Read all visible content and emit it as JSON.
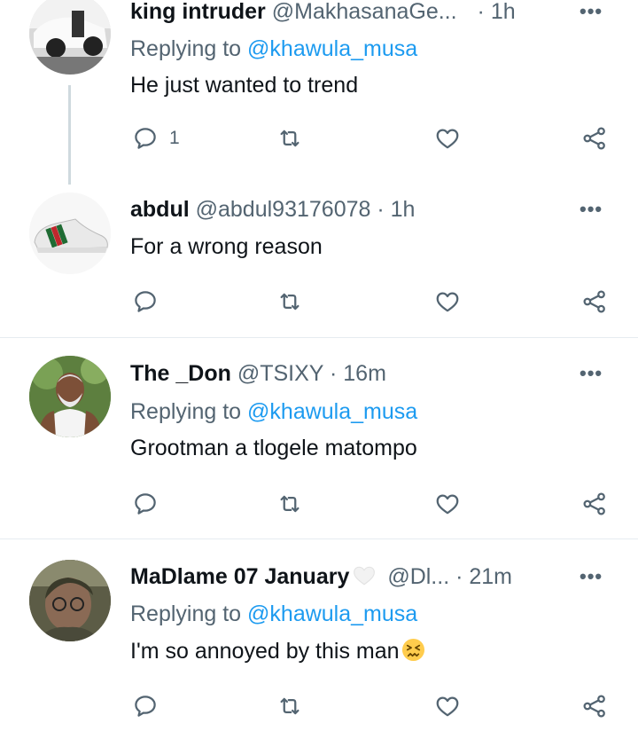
{
  "tweets": [
    {
      "name": "king intruder",
      "handle": "@MakhasanaGe...",
      "dot": "·",
      "time": "1h",
      "replying_prefix": "Replying to ",
      "replying_to": "@khawula_musa",
      "text": "He just wanted to trend",
      "reply_count": "1"
    },
    {
      "name": "abdul",
      "handle": "@abdul93176078",
      "dot": "·",
      "time": "1h",
      "text": "For a wrong reason"
    },
    {
      "name": "The _Don",
      "handle": "@TSIXY",
      "dot": "·",
      "time": "16m",
      "replying_prefix": "Replying to ",
      "replying_to": "@khawula_musa",
      "text": "Grootman a tlogele matompo"
    },
    {
      "name": "MaDlame 07 January",
      "handle": "@Dl...",
      "dot": "·",
      "time": "21m",
      "replying_prefix": "Replying to ",
      "replying_to": "@khawula_musa",
      "text": "I'm so annoyed by this man"
    }
  ],
  "more_label": "•••",
  "colors": {
    "link": "#1d9bf0",
    "secondary": "#536471",
    "divider": "#e6ecf0"
  },
  "icons": [
    "reply-icon",
    "retweet-icon",
    "like-icon",
    "share-icon",
    "more-icon",
    "persevering-face-emoji",
    "white-heart-emoji"
  ]
}
